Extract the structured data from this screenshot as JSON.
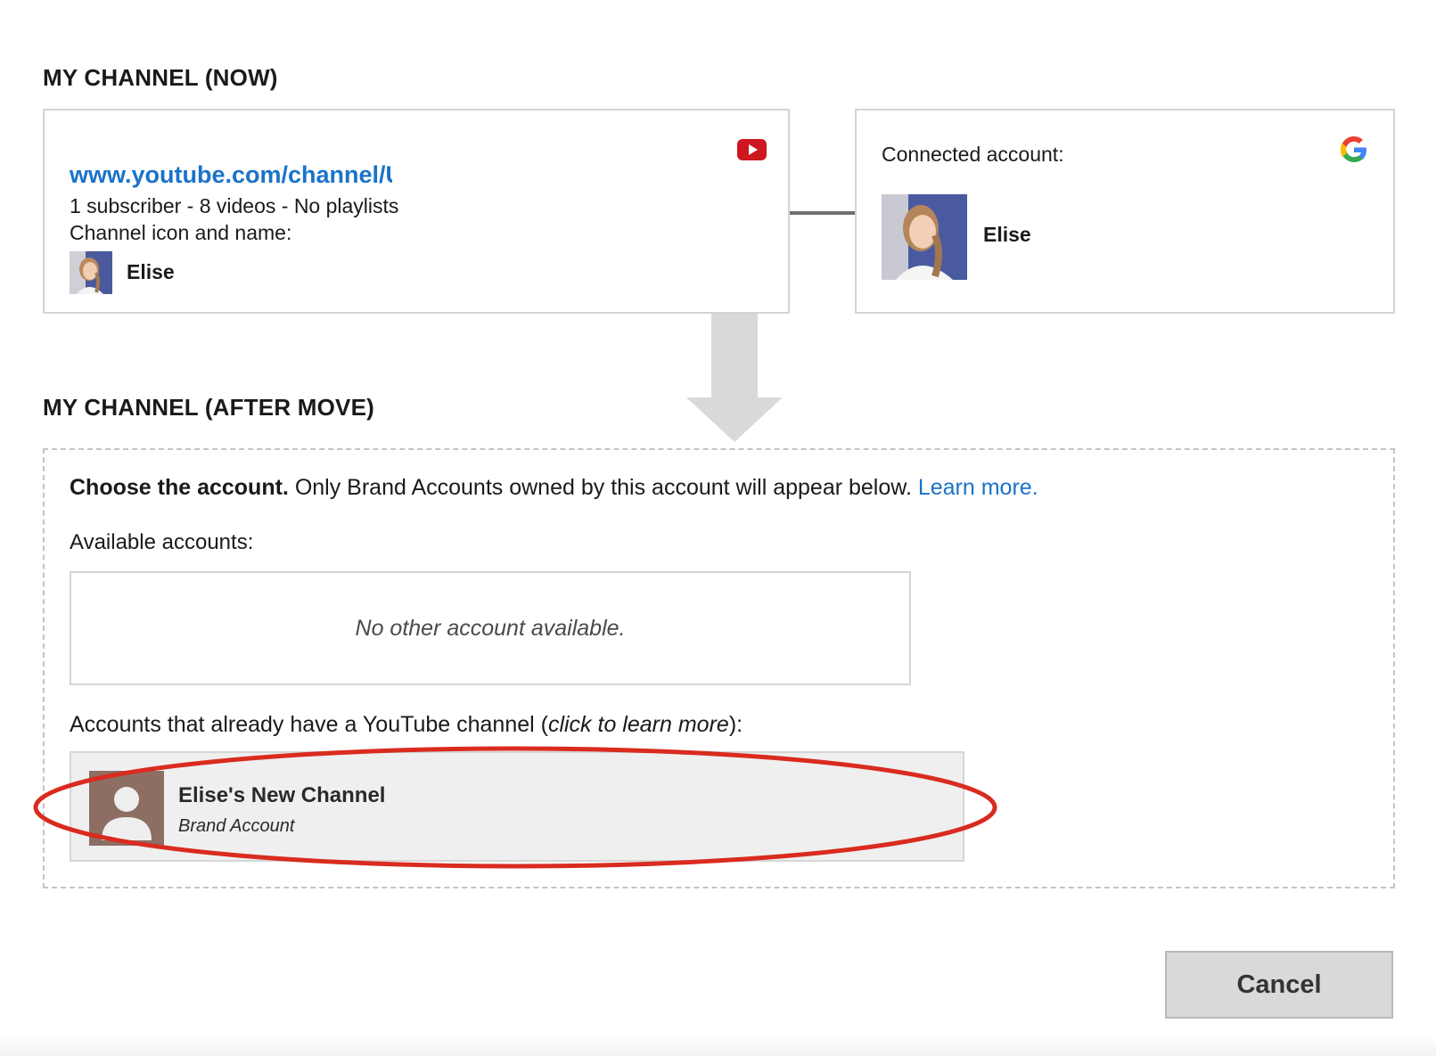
{
  "sections": {
    "now_title": "MY CHANNEL (NOW)",
    "after_title": "MY CHANNEL (AFTER MOVE)"
  },
  "channel_card": {
    "url": "www.youtube.com/channel/U",
    "stats": "1 subscriber - 8 videos - No playlists",
    "icon_label": "Channel icon and name:",
    "owner_name": "Elise",
    "icon": "youtube-play-icon"
  },
  "connected_card": {
    "label": "Connected account:",
    "name": "Elise",
    "icon": "google-g-icon"
  },
  "move_panel": {
    "instruction_bold": "Choose the account.",
    "instruction_text": " Only Brand Accounts owned by this account will appear below. ",
    "learn_more": "Learn more.",
    "available_label": "Available accounts:",
    "no_accounts": "No other account available.",
    "existing_prefix": "Accounts that already have a YouTube channel (",
    "existing_italic": "click to learn more",
    "existing_suffix": "):",
    "brand_account": {
      "name": "Elise's New Channel",
      "type": "Brand Account",
      "avatar_color": "#8d6e63"
    }
  },
  "actions": {
    "cancel_label": "Cancel"
  },
  "colors": {
    "link": "#1a73c8",
    "highlight": "#d92b1f",
    "youtube_red": "#cc181e"
  }
}
